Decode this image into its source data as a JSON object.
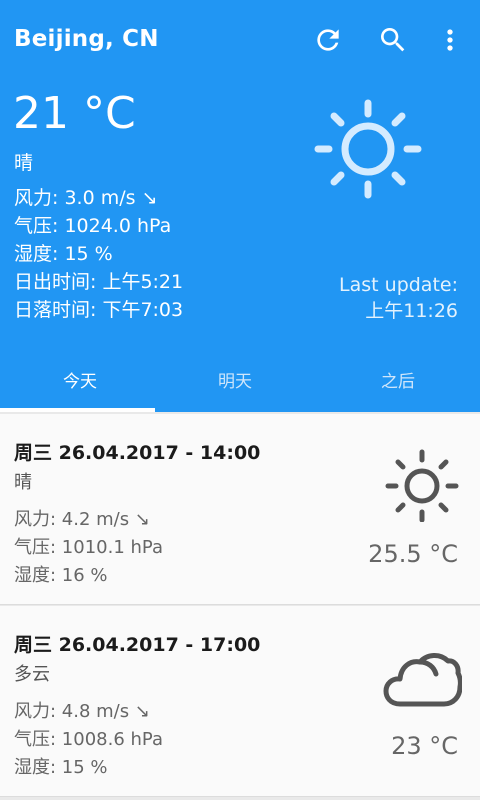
{
  "toolbar": {
    "title": "Beijing, CN",
    "refresh_icon": "refresh-icon",
    "search_icon": "search-icon",
    "more_icon": "more-vert-icon"
  },
  "current": {
    "temperature": "21 °C",
    "description": "晴",
    "wind": "风力: 3.0 m/s ↘",
    "pressure": "气压: 1024.0 hPa",
    "humidity": "湿度: 15 %",
    "sunrise": "日出时间: 上午5:21",
    "sunset": "日落时间: 下午7:03",
    "icon": "sun-icon",
    "last_update_label": "Last update:",
    "last_update_time": "上午11:26"
  },
  "tabs": [
    {
      "label": "今天",
      "active": true
    },
    {
      "label": "明天",
      "active": false
    },
    {
      "label": "之后",
      "active": false
    }
  ],
  "forecast": [
    {
      "date": "周三 26.04.2017 - 14:00",
      "description": "晴",
      "wind": "风力: 4.2 m/s ↘",
      "pressure": "气压: 1010.1 hPa",
      "humidity": "湿度: 16 %",
      "temperature": "25.5 °C",
      "icon": "sun-icon"
    },
    {
      "date": "周三 26.04.2017 - 17:00",
      "description": "多云",
      "wind": "风力: 4.8 m/s ↘",
      "pressure": "气压: 1008.6 hPa",
      "humidity": "湿度: 15 %",
      "temperature": "23 °C",
      "icon": "cloud-icon"
    }
  ],
  "colors": {
    "primary": "#2196f3",
    "card_background": "#fafafa",
    "icon_gray": "#555555"
  }
}
